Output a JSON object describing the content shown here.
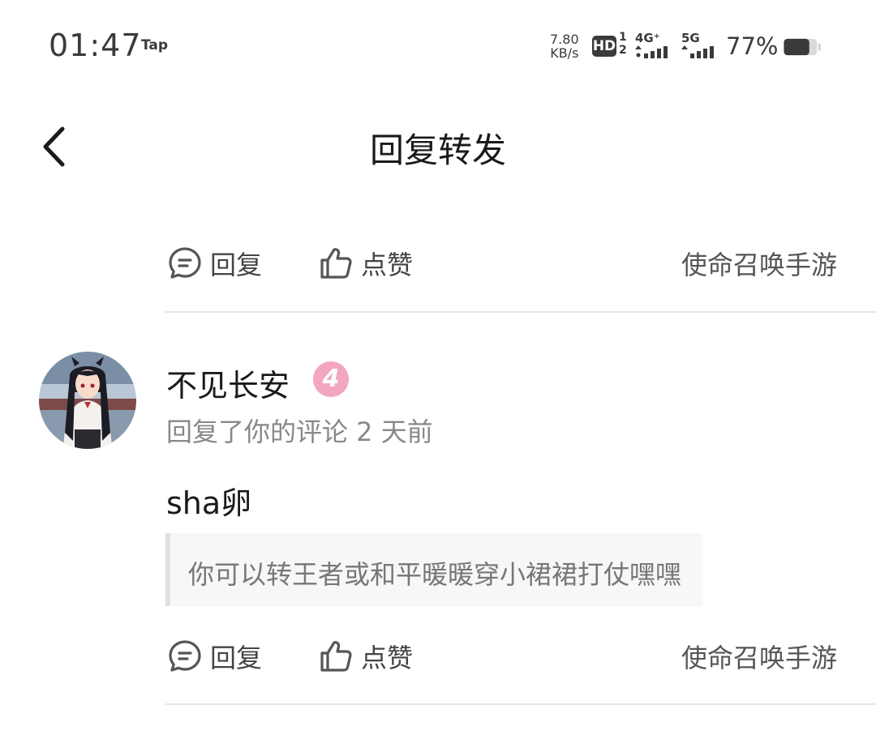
{
  "status_bar": {
    "time": "01:47",
    "tap": "Tap",
    "net_speed_value": "7.80",
    "net_speed_unit": "KB/s",
    "hd": "HD",
    "hd_sim_1": "1",
    "hd_sim_2": "2",
    "signal_1_label": "4G⁺",
    "signal_2_label": "5G",
    "battery_percent": "77%",
    "battery_level": 0.77
  },
  "header": {
    "title": "回复转发"
  },
  "top_actions": {
    "reply_label": "回复",
    "like_label": "点赞",
    "game_tag": "使命召唤手游"
  },
  "comment": {
    "username": "不见长安",
    "level": "4",
    "meta": "回复了你的评论 2 天前",
    "reply_text": "sha卵",
    "quoted_text": "你可以转王者或和平暖暖穿小裙裙打仗嘿嘿",
    "actions": {
      "reply_label": "回复",
      "like_label": "点赞",
      "game_tag": "使命召唤手游"
    }
  },
  "colors": {
    "level_badge": "#f3a6bf",
    "divider": "#e6e6e6"
  }
}
